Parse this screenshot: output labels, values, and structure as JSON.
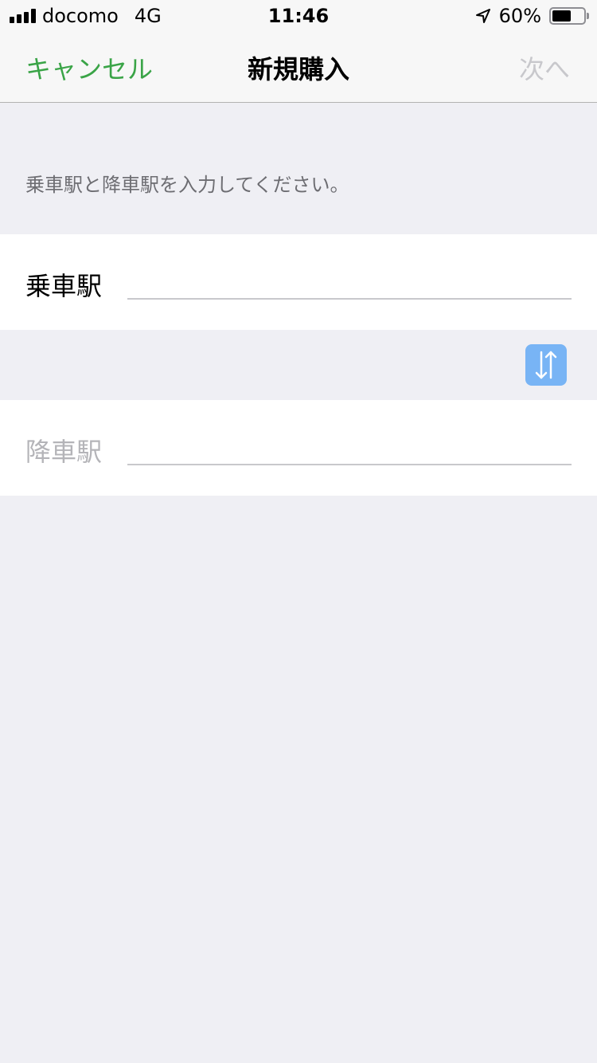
{
  "status_bar": {
    "carrier": "docomo",
    "network": "4G",
    "time": "11:46",
    "battery": "60%",
    "battery_level": 0.6
  },
  "nav": {
    "cancel_label": "キャンセル",
    "title": "新規購入",
    "next_label": "次へ"
  },
  "instruction": "乗車駅と降車駅を入力してください。",
  "form": {
    "boarding_label": "乗車駅",
    "boarding_value": "",
    "alighting_label": "降車駅",
    "alighting_value": ""
  },
  "colors": {
    "accent": "#3aa447",
    "disabled": "#c8c8cc",
    "swap_button": "#78b4f5",
    "background": "#efeff4"
  },
  "icons": {
    "swap": "swap-vertical-arrows-icon",
    "location": "location-arrow-icon"
  }
}
